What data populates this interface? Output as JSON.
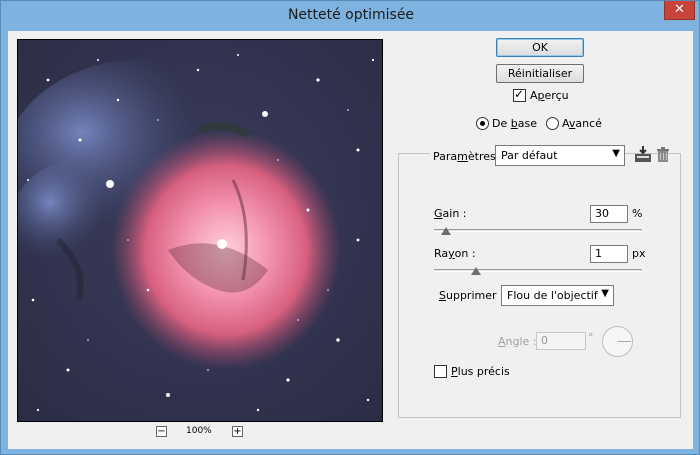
{
  "window": {
    "title": "Netteté optimisée",
    "close_glyph": "✕"
  },
  "buttons": {
    "ok": "OK",
    "reset": "Réinitialiser"
  },
  "preview_toggle": {
    "label_prefix": "A",
    "label_underlined": "p",
    "label_rest": "erçu",
    "checked": true
  },
  "mode": {
    "basic": {
      "label_prefix": "De ",
      "label_underlined": "b",
      "label_rest": "ase",
      "selected": true
    },
    "advanced": {
      "label_prefix": "A",
      "label_underlined": "v",
      "label_rest": "ancé",
      "selected": false
    }
  },
  "settings": {
    "label_prefix": "Para",
    "label_underlined": "m",
    "label_rest": "ètres :",
    "value": "Par défaut",
    "save_icon": "save-preset-icon",
    "delete_icon": "trash-icon"
  },
  "amount": {
    "label_underlined": "G",
    "label_rest": "ain :",
    "value": "30",
    "unit": "%",
    "slider_fraction": 0.06
  },
  "radius": {
    "label_prefix": "Ra",
    "label_underlined": "y",
    "label_rest": "on :",
    "value": "1",
    "unit": "px",
    "slider_fraction": 0.2
  },
  "remove": {
    "label_underlined": "S",
    "label_rest": "upprimer :",
    "value": "Flou de l'objectif"
  },
  "angle": {
    "label_underlined": "A",
    "label_rest": "ngle :",
    "value": "0",
    "unit": "°",
    "disabled": true
  },
  "more_accurate": {
    "label_underlined": "P",
    "label_rest": "lus précis",
    "checked": false
  },
  "zoom": {
    "level": "100%",
    "minus": "−",
    "plus": "+"
  },
  "colors": {
    "accent": "#3c7fb1",
    "window_frame": "#7fb3df",
    "close": "#c7443a"
  }
}
